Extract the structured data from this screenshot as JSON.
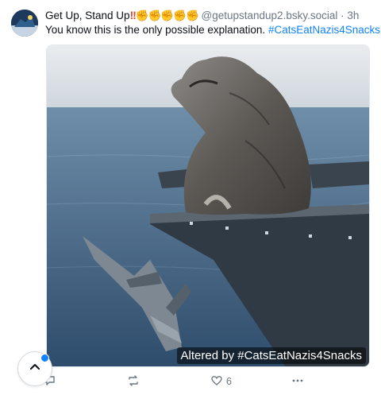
{
  "post": {
    "author_name": "Get Up, Stand Up",
    "author_emoji": "‼️✊🏻✊🏼✊🏽✊🏾✊🏿",
    "handle": "@getupstandup2.bsky.social",
    "separator": "·",
    "time": "3h",
    "text": "You know this is the only possible explanation.",
    "hashtag": "#CatsEatNazis4Snacks",
    "image_badge": "Altered by #CatsEatNazis4Snacks",
    "like_count": "6"
  },
  "icons": {
    "reply": "reply-icon",
    "repost": "repost-icon",
    "like": "heart-icon",
    "more": "more-icon",
    "scroll_top": "chevron-up-icon"
  },
  "colors": {
    "link": "#1083fe",
    "muted": "#6b7784"
  }
}
